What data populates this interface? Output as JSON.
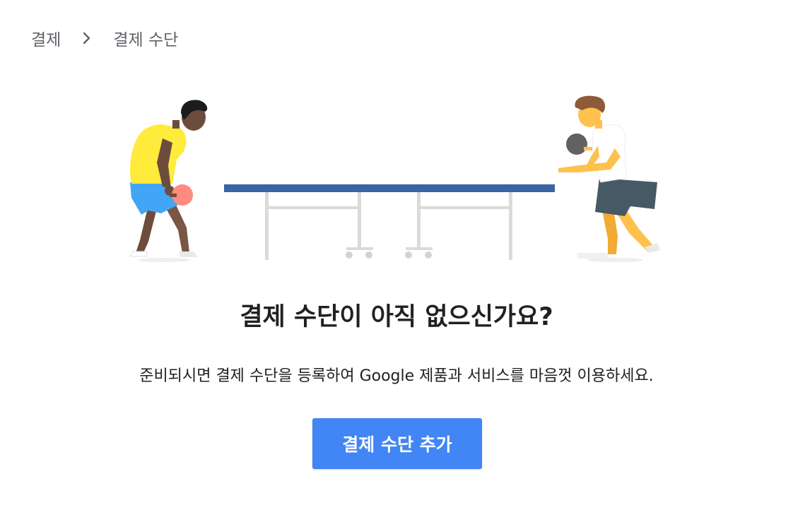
{
  "breadcrumb": {
    "items": [
      "결제",
      "결제 수단"
    ],
    "separator_icon": "chevron-right-icon"
  },
  "illustration": {
    "description_icon": "table-tennis-players-illustration"
  },
  "empty_state": {
    "title": "결제 수단이 아직 없으신가요?",
    "description": "준비되시면 결제 수단을 등록하여 Google 제품과 서비스를 마음껏 이용하세요.",
    "button_label": "결제 수단 추가"
  },
  "colors": {
    "accent": "#4285f4",
    "breadcrumb_text": "#5f6368",
    "title_text": "#202124",
    "table": "#3b64a3"
  }
}
